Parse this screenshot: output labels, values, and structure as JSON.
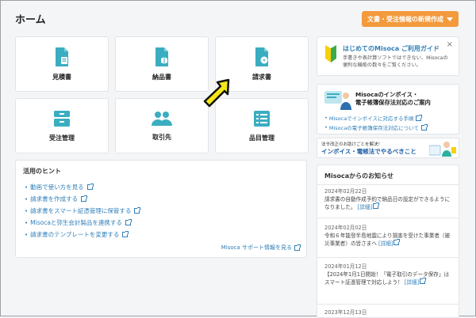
{
  "header": {
    "title": "ホーム",
    "new_button": "文書・受注情報の新規作成"
  },
  "tiles": [
    {
      "label": "見積書",
      "icon": "estimate-document-icon"
    },
    {
      "label": "納品書",
      "icon": "delivery-document-icon"
    },
    {
      "label": "請求書",
      "icon": "invoice-document-icon"
    },
    {
      "label": "受注管理",
      "icon": "order-tray-icon"
    },
    {
      "label": "取引先",
      "icon": "clients-people-icon"
    },
    {
      "label": "品目管理",
      "icon": "item-list-icon"
    }
  ],
  "hints": {
    "title": "活用のヒント",
    "links": [
      "動画で使い方を見る",
      "請求書を作成する",
      "請求書をスマート証憑管理に保管する",
      "Misocaと弥生会計製品を連携する",
      "請求書のテンプレートを変更する"
    ],
    "support_link": "Misoca サポート情報を見る"
  },
  "guide": {
    "title": "はじめてのMisoca ご利用ガイド",
    "desc": "手書きや表計算ソフトではできない、Misocaの便利な機能の数々をご覧ください。",
    "close": "×"
  },
  "invoice_panel": {
    "title_line1": "Misocaのインボイス・",
    "title_line2": "電子帳簿保存法対応のご案内",
    "link1": "Misocaでインボイスに対応する手順",
    "link2": "Misocaの電子帳簿保存法対応について"
  },
  "banner": {
    "line1": "法令改正のお助けごとを解決！",
    "line2": "インボイス・電帳法でやるべきこと"
  },
  "news": {
    "title": "Misocaからのお知らせ",
    "items": [
      {
        "date": "2024年02月22日",
        "text": "請求書の自動作成予約で納品日の設定ができるようになりました。",
        "more": "[詳細]"
      },
      {
        "date": "2024年02月02日",
        "text": "令和６年能登半島地震により損害を受けた事業者（被災事業者）の皆さまへ",
        "more": "[詳細]"
      },
      {
        "date": "2024年01月12日",
        "text": "【2024年1月1日開始！「電子取引のデータ保存」はスマート証憑管理で対応しよう！",
        "more": "[詳細]"
      },
      {
        "date": "2023年12月13日",
        "text": "",
        "more": ""
      }
    ]
  },
  "colors": {
    "accent_orange": "#f39a3d",
    "tile_icon_teal": "#3aaec0",
    "link_blue": "#2f7fb8",
    "cursor_yellow": "#f5e61b"
  }
}
